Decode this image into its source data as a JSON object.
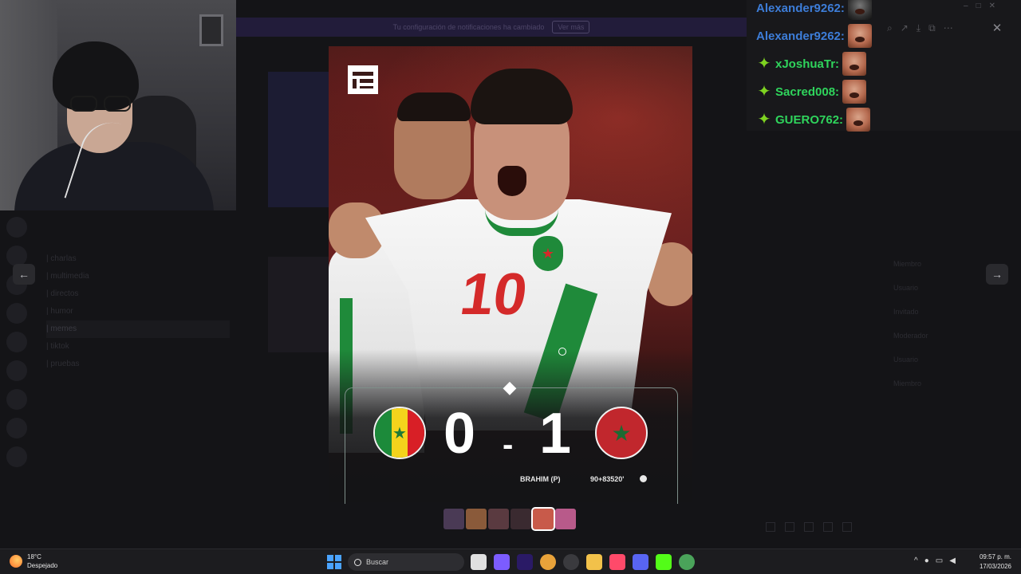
{
  "chat": {
    "messages": [
      {
        "user": "Alexander9262:",
        "color": "#3d7dd8",
        "badge": false,
        "emote": "dark"
      },
      {
        "user": "Alexander9262:",
        "color": "#3d7dd8",
        "badge": false,
        "emote": "face"
      },
      {
        "user": "xJoshuaTr:",
        "color": "#2fd45c",
        "badge": true,
        "emote": "face"
      },
      {
        "user": "Sacred008:",
        "color": "#2fd45c",
        "badge": true,
        "emote": "face"
      },
      {
        "user": "GUERO762:",
        "color": "#2fd45c",
        "badge": true,
        "emote": "face"
      }
    ],
    "badge_icon": "green-sparkle-icon"
  },
  "background": {
    "banner_text": "Tu configuración de notificaciones ha cambiado",
    "banner_button": "Ver más",
    "channels": [
      "| charlas",
      "| multimedia",
      "| directos",
      "| humor",
      "| memes",
      "| tiktok",
      "| pruebas"
    ],
    "members": [
      "Miembro",
      "Usuario",
      "Invitado",
      "Moderador",
      "Usuario",
      "Miembro"
    ]
  },
  "viewer": {
    "nav_prev_icon": "arrow-left-icon",
    "nav_next_icon": "arrow-right-icon",
    "close_icon": "close-icon",
    "tools": [
      "zoom-icon",
      "share-icon",
      "download-icon",
      "open-external-icon",
      "more-icon"
    ]
  },
  "match": {
    "home_team": "Senegal",
    "away_team": "Morocco",
    "home_score": "0",
    "separator": "-",
    "away_score": "1",
    "scorer": "BRAHIM (P)",
    "minute": "90+83520'",
    "jersey_number": "10",
    "colors": {
      "morocco_red": "#c1272d",
      "morocco_green": "#1c6a32",
      "senegal_green": "#1c8a3a",
      "senegal_yellow": "#f4d31c",
      "senegal_red": "#d81f26"
    }
  },
  "thumbnails": [
    {
      "color": "#4a3a55"
    },
    {
      "color": "#8a5a3a"
    },
    {
      "color": "#5a3a40"
    },
    {
      "color": "#3a2a30"
    },
    {
      "color": "#c85a4a",
      "selected": true
    },
    {
      "color": "#b85a8a"
    }
  ],
  "taskbar": {
    "temperature": "18°C",
    "weather": "Despejado",
    "search_placeholder": "Buscar",
    "apps": [
      {
        "name": "file-explorer-icon",
        "color": "#e0e0e0"
      },
      {
        "name": "copilot-icon",
        "color": "#7c5cff"
      },
      {
        "name": "premiere-icon",
        "color": "#2a1a66"
      },
      {
        "name": "chrome-icon",
        "color": "#e8a23a"
      },
      {
        "name": "obs-icon",
        "color": "#3a3a3e"
      },
      {
        "name": "folder-icon",
        "color": "#f2c14a"
      },
      {
        "name": "music-icon",
        "color": "#ff4a6a"
      },
      {
        "name": "discord-icon",
        "color": "#5865f2"
      },
      {
        "name": "kick-icon",
        "color": "#53fc18"
      },
      {
        "name": "chrome-alt-icon",
        "color": "#4aa35a"
      }
    ],
    "time": "09:57 p. m.",
    "date": "17/03/2026"
  }
}
